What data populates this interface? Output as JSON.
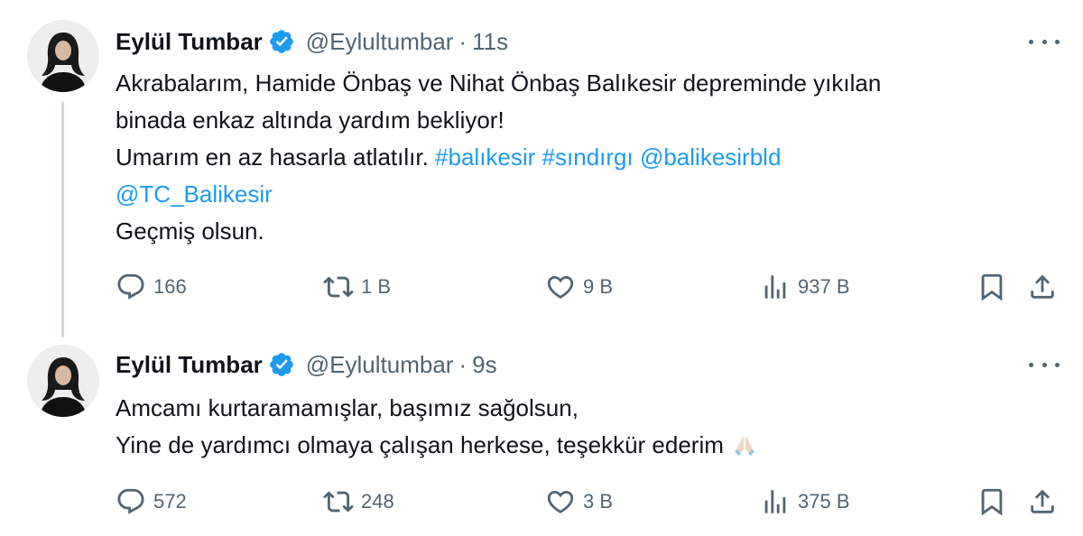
{
  "tweets": [
    {
      "author_name": "Eylül Tumbar",
      "handle": "@Eylultumbar",
      "separator": "·",
      "time": "11s",
      "text_lines": [
        [
          {
            "t": "Akrabalarım, Hamide Önbaş ve Nihat Önbaş Balıkesir depreminde yıkılan",
            "link": false
          }
        ],
        [
          {
            "t": "binada enkaz altında yardım bekliyor!",
            "link": false
          }
        ],
        [
          {
            "t": "Umarım en az hasarla atlatılır. ",
            "link": false
          },
          {
            "t": "#balıkesir",
            "link": true
          },
          {
            "t": " ",
            "link": false
          },
          {
            "t": "#sındırgı",
            "link": true
          },
          {
            "t": " ",
            "link": false
          },
          {
            "t": "@balikesirbld",
            "link": true
          }
        ],
        [
          {
            "t": "@TC_Balikesir",
            "link": true
          }
        ],
        [
          {
            "t": "Geçmiş olsun.",
            "link": false
          }
        ]
      ],
      "has_emoji": false,
      "stats": {
        "replies": "166",
        "reposts": "1 B",
        "likes": "9 B",
        "views": "937 B"
      }
    },
    {
      "author_name": "Eylül Tumbar",
      "handle": "@Eylultumbar",
      "separator": "·",
      "time": "9s",
      "text_lines": [
        [
          {
            "t": "Amcamı kurtaramamışlar, başımız sağolsun,",
            "link": false
          }
        ],
        [
          {
            "t": "Yine de yardımcı olmaya çalışan herkese, teşekkür ederim",
            "link": false
          }
        ]
      ],
      "has_emoji": true,
      "emoji_name": "folded-hands-emoji",
      "stats": {
        "replies": "572",
        "reposts": "248",
        "likes": "3 B",
        "views": "375 B"
      }
    }
  ],
  "icons": {
    "verified": "verified-badge-icon",
    "more": "more-options-icon",
    "reply": "reply-icon",
    "repost": "repost-icon",
    "like": "like-heart-icon",
    "views": "views-chart-icon",
    "bookmark": "bookmark-icon",
    "share": "share-icon"
  },
  "colors": {
    "text": "#0f1419",
    "secondary": "#536471",
    "link": "#1d9bf0",
    "verified": "#1d9bf0",
    "thread_line": "#cfd9de"
  }
}
